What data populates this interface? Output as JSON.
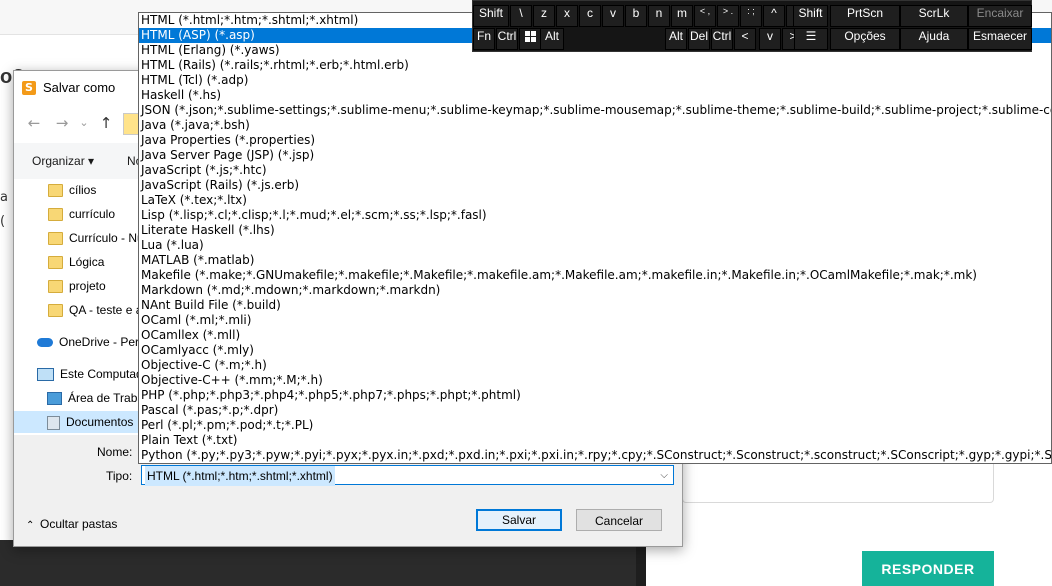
{
  "background": {
    "question_mark": "o?",
    "left_text_a": "a",
    "left_text_p": "(",
    "respond_button": "RESPONDER"
  },
  "dialog": {
    "title": "Salvar como",
    "app_icon_letter": "S",
    "nav_icons": [
      "back-arrow-icon",
      "forward-arrow-icon",
      "chevron-down-icon",
      "up-arrow-icon"
    ],
    "nav_glyphs": [
      "←",
      "→",
      "⌄",
      "↑"
    ],
    "toolbar": {
      "organize": "Organizar ▾",
      "new_folder_partial": "No"
    },
    "tree": [
      {
        "label": "cílios",
        "icon": "folder"
      },
      {
        "label": "currículo",
        "icon": "folder"
      },
      {
        "label": "Currículo - Nu",
        "icon": "folder"
      },
      {
        "label": "Lógica",
        "icon": "folder"
      },
      {
        "label": "projeto",
        "icon": "folder"
      },
      {
        "label": "QA - teste e a",
        "icon": "folder"
      },
      {
        "label": "OneDrive - Pers",
        "icon": "cloud"
      },
      {
        "label": "Este Computad",
        "icon": "pc"
      },
      {
        "label": "Área de Traba",
        "icon": "desktop"
      },
      {
        "label": "Documentos",
        "icon": "document",
        "selected": true
      }
    ],
    "name_label": "Nome:",
    "type_label": "Tipo:",
    "type_value": "HTML (*.html;*.htm;*.shtml;*.xhtml)",
    "hide_folders": "Ocultar pastas",
    "save_button": "Salvar",
    "cancel_button": "Cancelar"
  },
  "dropdown": {
    "items": [
      "HTML (*.html;*.htm;*.shtml;*.xhtml)",
      "HTML (ASP) (*.asp)",
      "HTML (Erlang) (*.yaws)",
      "HTML (Rails) (*.rails;*.rhtml;*.erb;*.html.erb)",
      "HTML (Tcl) (*.adp)",
      "Haskell (*.hs)",
      "JSON (*.json;*.sublime-settings;*.sublime-menu;*.sublime-keymap;*.sublime-mousemap;*.sublime-theme;*.sublime-build;*.sublime-project;*.sublime-completions;*.sublim",
      "Java (*.java;*.bsh)",
      "Java Properties (*.properties)",
      "Java Server Page (JSP) (*.jsp)",
      "JavaScript (*.js;*.htc)",
      "JavaScript (Rails) (*.js.erb)",
      "LaTeX (*.tex;*.ltx)",
      "Lisp (*.lisp;*.cl;*.clisp;*.l;*.mud;*.el;*.scm;*.ss;*.lsp;*.fasl)",
      "Literate Haskell (*.lhs)",
      "Lua (*.lua)",
      "MATLAB (*.matlab)",
      "Makefile (*.make;*.GNUmakefile;*.makefile;*.Makefile;*.makefile.am;*.Makefile.am;*.makefile.in;*.Makefile.in;*.OCamlMakefile;*.mak;*.mk)",
      "Markdown (*.md;*.mdown;*.markdown;*.markdn)",
      "NAnt Build File (*.build)",
      "OCaml (*.ml;*.mli)",
      "OCamllex (*.mll)",
      "OCamlyacc (*.mly)",
      "Objective-C (*.m;*.h)",
      "Objective-C++ (*.mm;*.M;*.h)",
      "PHP (*.php;*.php3;*.php4;*.php5;*.php7;*.phps;*.phpt;*.phtml)",
      "Pascal (*.pas;*.p;*.dpr)",
      "Perl (*.pl;*.pm;*.pod;*.t;*.PL)",
      "Plain Text (*.txt)",
      "Python (*.py;*.py3;*.pyw;*.pyi;*.pyx;*.pyx.in;*.pxd;*.pxd.in;*.pxi;*.pxi.in;*.rpy;*.cpy;*.SConstruct;*.Sconstruct;*.sconstruct;*.SConscript;*.gyp;*.gypi;*.Snakefile;*.vpy;*.wscript)"
    ],
    "highlighted_index": 1
  },
  "keyboard": {
    "row1": [
      {
        "label": "Shift",
        "name": "key-shift-left"
      },
      {
        "label": "\\",
        "name": "key-backslash"
      },
      {
        "label": "z",
        "name": "key-z"
      },
      {
        "label": "x",
        "name": "key-x"
      },
      {
        "label": "c",
        "name": "key-c"
      },
      {
        "label": "v",
        "name": "key-v"
      },
      {
        "label": "b",
        "name": "key-b"
      },
      {
        "label": "n",
        "name": "key-n"
      },
      {
        "label": "m",
        "name": "key-m"
      },
      {
        "label": "< ,",
        "name": "key-comma"
      },
      {
        "label": "> .",
        "name": "key-period"
      },
      {
        "label": ": ;",
        "name": "key-semicolon"
      },
      {
        "label": "^",
        "name": "key-up-arrow"
      },
      {
        "label": "? /",
        "name": "key-slash"
      },
      {
        "label": "Shift",
        "name": "key-shift-right"
      },
      {
        "label": "PrtScn",
        "name": "key-prtscn"
      },
      {
        "label": "ScrLk",
        "name": "key-scrlk"
      },
      {
        "label": "Encaixar",
        "name": "key-encaixar",
        "dim": true
      }
    ],
    "row2": [
      {
        "label": "Fn",
        "name": "key-fn"
      },
      {
        "label": "Ctrl",
        "name": "key-ctrl-left"
      },
      {
        "label": "",
        "name": "key-windows"
      },
      {
        "label": "Alt",
        "name": "key-alt-left"
      },
      {
        "label": "Alt",
        "name": "key-alt-right"
      },
      {
        "label": "Del",
        "name": "key-del"
      },
      {
        "label": "Ctrl",
        "name": "key-ctrl-right"
      },
      {
        "label": "<",
        "name": "key-left-arrow"
      },
      {
        "label": "v",
        "name": "key-down-arrow"
      },
      {
        "label": ">",
        "name": "key-right-arrow"
      },
      {
        "label": "☰",
        "name": "key-menu"
      },
      {
        "label": "Opções",
        "name": "key-opcoes"
      },
      {
        "label": "Ajuda",
        "name": "key-ajuda"
      },
      {
        "label": "Esmaecer",
        "name": "key-esmaecer"
      }
    ]
  }
}
